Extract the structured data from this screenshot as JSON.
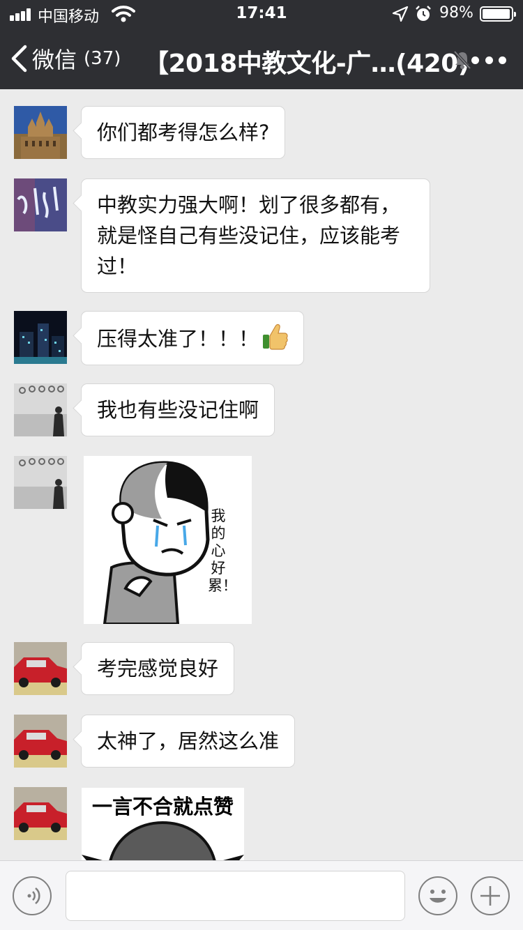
{
  "status_bar": {
    "carrier": "中国移动",
    "time": "17:41",
    "battery": "98%",
    "battery_level": 0.98
  },
  "nav": {
    "back_label": "微信",
    "back_count": "(37)",
    "title": "【2018中教文化-广…(420)",
    "icons": [
      "chevron-left-icon",
      "bell-muted-icon",
      "more-icon"
    ]
  },
  "messages": [
    {
      "type": "text",
      "text": "你们都考得怎么样?"
    },
    {
      "type": "text",
      "lines": [
        "中教实力强大啊！划了很多都有，",
        "就是怪自己有些没记住，应该能考",
        "过！"
      ]
    },
    {
      "type": "text",
      "text": "压得太准了！！！",
      "emoji": "thumbs-up-icon"
    },
    {
      "type": "text",
      "text": "我也有些没记住啊"
    },
    {
      "type": "sticker",
      "text": "我的心好累！"
    },
    {
      "type": "text",
      "text": "考完感觉良好"
    },
    {
      "type": "text",
      "text": "太神了，居然这么准"
    },
    {
      "type": "sticker",
      "caption": "一言不合就点赞"
    }
  ],
  "input_bar": {
    "icons": [
      "voice-icon",
      "emoji-icon",
      "plus-icon"
    ],
    "value": ""
  },
  "colors": {
    "header_bg": "#2e2f33",
    "chat_bg": "#ebebeb",
    "bubble_bg": "#ffffff"
  }
}
